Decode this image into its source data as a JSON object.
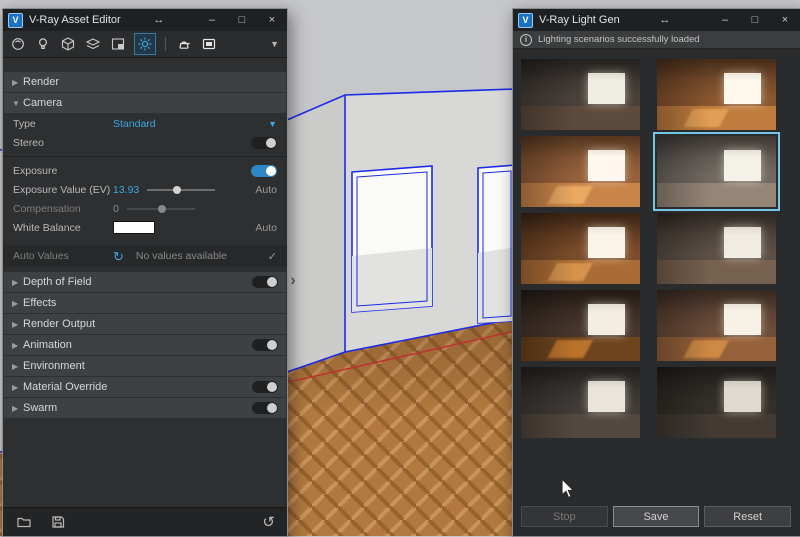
{
  "glyphs": {
    "logo": "V",
    "dock": "↔",
    "minimize": "–",
    "maximize": "□",
    "close": "×",
    "caret_collapsed": "▶",
    "caret_expanded": "▼",
    "chevron_down": "▼",
    "check": "✓",
    "refresh": "↻",
    "undo": "↺",
    "collapse_right": "›",
    "info": "i"
  },
  "colors": {
    "accent": "#3ba7e0",
    "selection": "#74c6e4",
    "edge_blue": "#1b2ae8",
    "axis_red": "#c03030"
  },
  "asset_editor": {
    "title": "V-Ray Asset Editor",
    "toolbar_icons": [
      "materials",
      "lights",
      "geometry",
      "textures",
      "compositing",
      "settings",
      "render",
      "render-frame",
      "more"
    ],
    "sections": [
      {
        "label": "Render",
        "expanded": false
      },
      {
        "label": "Camera",
        "expanded": true
      },
      {
        "label": "Depth of Field",
        "expanded": false,
        "has_toggle": true,
        "toggle_on": false
      },
      {
        "label": "Effects",
        "expanded": false
      },
      {
        "label": "Render Output",
        "expanded": false
      },
      {
        "label": "Animation",
        "expanded": false,
        "has_toggle": true,
        "toggle_on": false
      },
      {
        "label": "Environment",
        "expanded": false
      },
      {
        "label": "Material Override",
        "expanded": false,
        "has_toggle": true,
        "toggle_on": false
      },
      {
        "label": "Swarm",
        "expanded": false,
        "has_toggle": true,
        "toggle_on": false
      }
    ],
    "camera": {
      "type_label": "Type",
      "type_value": "Standard",
      "stereo_label": "Stereo",
      "stereo_on": false,
      "exposure_label": "Exposure",
      "exposure_on": true,
      "ev_label": "Exposure Value (EV)",
      "ev_value": "13.93",
      "ev_auto_label": "Auto",
      "compensation_label": "Compensation",
      "compensation_value": "0",
      "white_balance_label": "White Balance",
      "wb_auto_label": "Auto",
      "auto_values_label": "Auto Values",
      "auto_values_status": "No values available"
    }
  },
  "light_gen": {
    "title": "V-Ray Light Gen",
    "status_message": "Lighting scenarios successfully loaded",
    "footer_buttons": [
      {
        "label": "Stop",
        "enabled": false
      },
      {
        "label": "Save",
        "enabled": true
      },
      {
        "label": "Reset",
        "enabled": true
      }
    ],
    "thumbnails": [
      {
        "ceiling": "#2e2a28",
        "wall": "#4a413b",
        "floor": "#5c4a3c",
        "window": "#efece3",
        "selected": false
      },
      {
        "ceiling": "#5a3a22",
        "wall": "#8a562f",
        "floor": "#c07c3e",
        "window": "#fdf7ec",
        "patch": "#e8a558",
        "selected": false
      },
      {
        "ceiling": "#6a4528",
        "wall": "#96603a",
        "floor": "#c98449",
        "window": "#fdf9f0",
        "patch": "#f0b068",
        "selected": false
      },
      {
        "ceiling": "#4e4843",
        "wall": "#716962",
        "floor": "#958577",
        "window": "#f4f1e9",
        "selected": true
      },
      {
        "ceiling": "#4a2d1a",
        "wall": "#7b4c2a",
        "floor": "#aa6c36",
        "window": "#fbf4e8",
        "patch": "#dd9a50",
        "selected": false
      },
      {
        "ceiling": "#3c332d",
        "wall": "#5c5047",
        "floor": "#77614f",
        "window": "#f1ece1",
        "selected": false
      },
      {
        "ceiling": "#2c211b",
        "wall": "#46362c",
        "floor": "#6e441f",
        "window": "#f4eee0",
        "patch": "#c87c2e",
        "selected": false
      },
      {
        "ceiling": "#47342a",
        "wall": "#6b4c39",
        "floor": "#96613a",
        "window": "#f8f2e6",
        "patch": "#d89048",
        "selected": false
      },
      {
        "ceiling": "#2b2826",
        "wall": "#403b37",
        "floor": "#52483f",
        "window": "#e9e5db",
        "selected": false
      },
      {
        "ceiling": "#262321",
        "wall": "#343029",
        "floor": "#423a33",
        "window": "#dfdacf",
        "selected": false
      }
    ]
  }
}
